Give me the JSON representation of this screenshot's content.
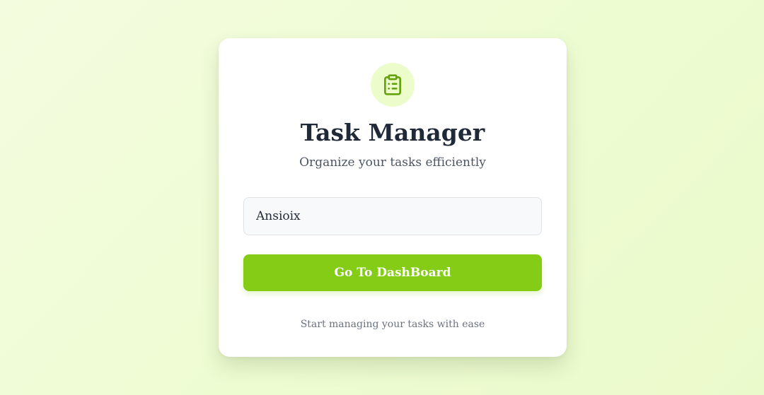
{
  "card": {
    "icon": "clipboard-list-icon",
    "title": "Task Manager",
    "subtitle": "Organize your tasks efficiently"
  },
  "name_input": {
    "value": "Ansioix"
  },
  "go_button": {
    "label": "Go To DashBoard"
  },
  "footer": {
    "text": "Start managing your tasks with ease"
  },
  "colors": {
    "accent": "#84cc16",
    "icon": "#65a30d",
    "icon_background": "#ecfccb",
    "title": "#1f2937"
  }
}
